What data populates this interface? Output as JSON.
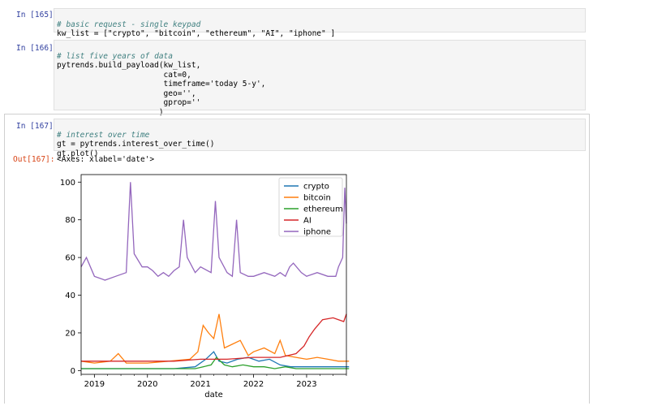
{
  "cells": [
    {
      "prompt": "In [165]:",
      "lines": [
        {
          "comment": "# basic request - single keypad"
        },
        {
          "code": "kw_list = [\"crypto\", \"bitcoin\", \"ethereum\", \"AI\", \"iphone\" ]"
        }
      ]
    },
    {
      "prompt": "In [166]:",
      "lines": [
        {
          "comment": "# list five years of data"
        },
        {
          "code": "pytrends.build_payload(kw_list,"
        },
        {
          "code": "                       cat=0,"
        },
        {
          "code": "                       timeframe='today 5-y',"
        },
        {
          "code": "                       geo='',"
        },
        {
          "code": "                       gprop=''"
        },
        {
          "code": "                      )"
        }
      ]
    },
    {
      "prompt": "In [167]:",
      "lines": [
        {
          "comment": "# interest over time"
        },
        {
          "code": "gt = pytrends.interest_over_time()"
        },
        {
          "code": "gt.plot()"
        }
      ]
    }
  ],
  "output": {
    "prompt": "Out[167]:",
    "text": "<Axes: xlabel='date'>"
  },
  "chart_data": {
    "type": "line",
    "xlabel": "date",
    "ylabel": "",
    "ylim": [
      -2,
      104
    ],
    "xlim": [
      "2018-10",
      "2023-10"
    ],
    "x_ticks": [
      "2019",
      "2020",
      "2021",
      "2022",
      "2023"
    ],
    "y_ticks": [
      0,
      20,
      40,
      60,
      80,
      100
    ],
    "legend_position": "top-right",
    "grid": false,
    "series": [
      {
        "name": "crypto",
        "color": "#1f77b4",
        "x": [
          2018.75,
          2019.0,
          2019.5,
          2020.0,
          2020.5,
          2020.9,
          2021.1,
          2021.25,
          2021.35,
          2021.5,
          2021.7,
          2021.9,
          2022.1,
          2022.3,
          2022.5,
          2022.7,
          2022.9,
          2023.1,
          2023.4,
          2023.8
        ],
        "values": [
          1,
          1,
          1,
          1,
          1,
          2,
          6,
          10,
          5,
          4,
          6,
          7,
          5,
          6,
          3,
          2,
          2,
          2,
          2,
          2
        ]
      },
      {
        "name": "bitcoin",
        "color": "#ff7f0e",
        "x": [
          2018.75,
          2019.0,
          2019.3,
          2019.45,
          2019.6,
          2020.0,
          2020.4,
          2020.8,
          2020.95,
          2021.05,
          2021.15,
          2021.25,
          2021.35,
          2021.45,
          2021.6,
          2021.75,
          2021.9,
          2022.0,
          2022.2,
          2022.4,
          2022.5,
          2022.6,
          2022.8,
          2023.0,
          2023.2,
          2023.4,
          2023.6,
          2023.8
        ],
        "values": [
          5,
          4,
          5,
          9,
          4,
          4,
          5,
          6,
          10,
          24,
          20,
          17,
          30,
          12,
          14,
          16,
          8,
          10,
          12,
          9,
          16,
          8,
          7,
          6,
          7,
          6,
          5,
          5
        ]
      },
      {
        "name": "ethereum",
        "color": "#2ca02c",
        "x": [
          2018.75,
          2019.0,
          2019.5,
          2020.0,
          2020.5,
          2020.9,
          2021.05,
          2021.2,
          2021.3,
          2021.45,
          2021.6,
          2021.8,
          2022.0,
          2022.2,
          2022.4,
          2022.6,
          2022.8,
          2023.0,
          2023.4,
          2023.8
        ],
        "values": [
          1,
          1,
          1,
          1,
          1,
          1,
          2,
          3,
          7,
          3,
          2,
          3,
          2,
          2,
          1,
          2,
          1,
          1,
          1,
          1
        ]
      },
      {
        "name": "AI",
        "color": "#d62728",
        "x": [
          2018.75,
          2019.0,
          2019.5,
          2020.0,
          2020.5,
          2021.0,
          2021.5,
          2022.0,
          2022.5,
          2022.8,
          2022.95,
          2023.05,
          2023.15,
          2023.3,
          2023.5,
          2023.7,
          2023.75
        ],
        "values": [
          5,
          5,
          5,
          5,
          5,
          6,
          6,
          7,
          7,
          9,
          13,
          18,
          22,
          27,
          28,
          26,
          30
        ]
      },
      {
        "name": "iphone",
        "color": "#9467bd",
        "x": [
          2018.75,
          2018.85,
          2019.0,
          2019.2,
          2019.4,
          2019.6,
          2019.68,
          2019.75,
          2019.9,
          2020.0,
          2020.1,
          2020.2,
          2020.3,
          2020.4,
          2020.5,
          2020.6,
          2020.68,
          2020.75,
          2020.9,
          2021.0,
          2021.2,
          2021.28,
          2021.35,
          2021.5,
          2021.6,
          2021.68,
          2021.75,
          2021.9,
          2022.0,
          2022.2,
          2022.4,
          2022.5,
          2022.6,
          2022.68,
          2022.75,
          2022.9,
          2023.0,
          2023.2,
          2023.4,
          2023.55,
          2023.6,
          2023.68,
          2023.72,
          2023.75
        ],
        "values": [
          55,
          60,
          50,
          48,
          50,
          52,
          100,
          62,
          55,
          55,
          53,
          50,
          52,
          50,
          53,
          55,
          80,
          60,
          52,
          55,
          52,
          90,
          60,
          52,
          50,
          80,
          52,
          50,
          50,
          52,
          50,
          52,
          50,
          55,
          57,
          52,
          50,
          52,
          50,
          50,
          55,
          60,
          97,
          78
        ]
      }
    ]
  }
}
